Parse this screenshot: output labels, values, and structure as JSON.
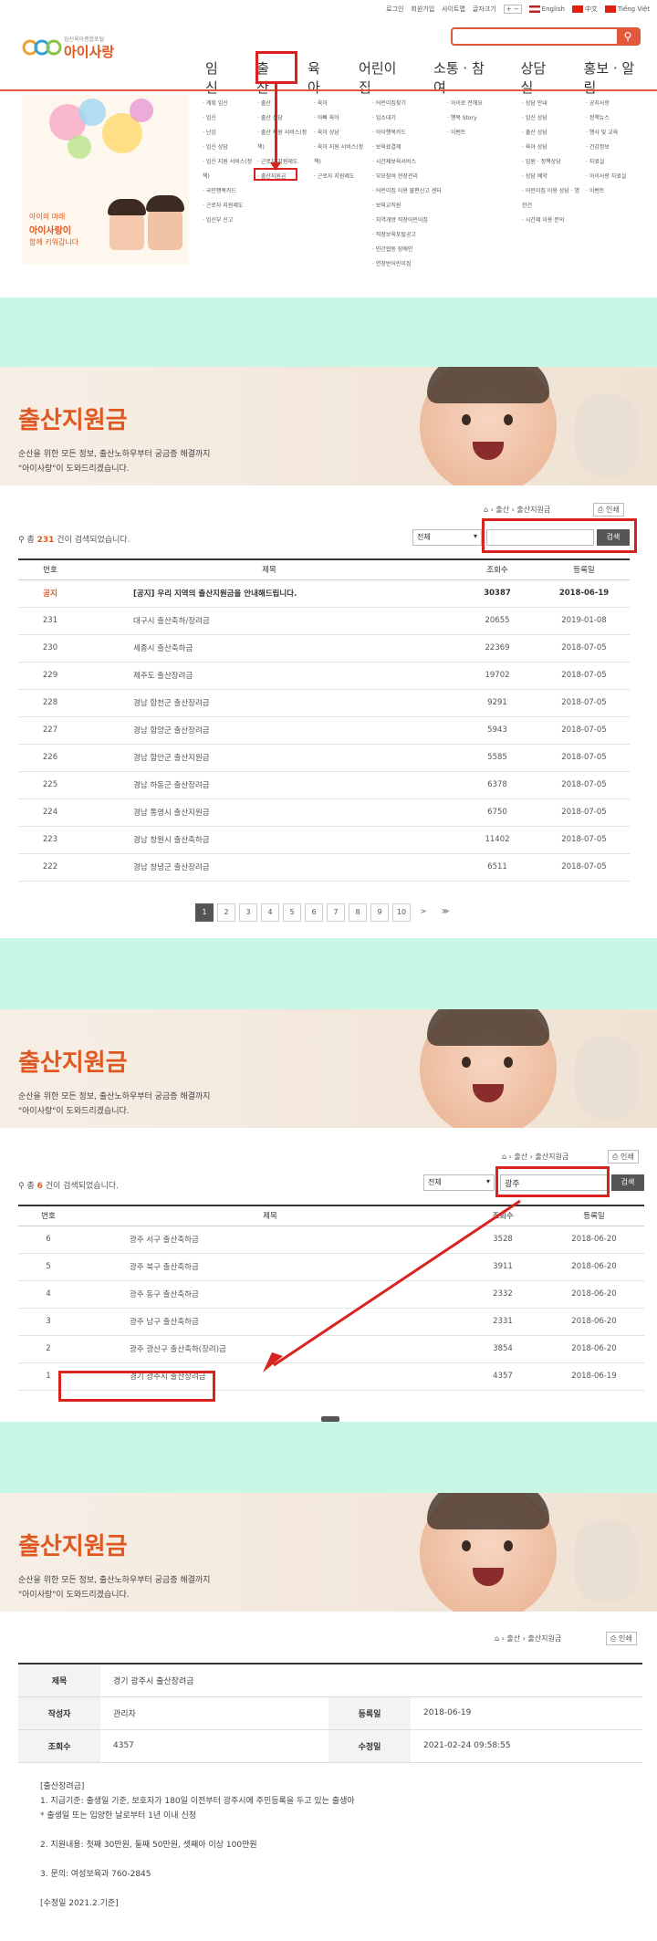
{
  "header": {
    "util": [
      "로그인",
      "회원가입",
      "사이트맵",
      "글자크기",
      "English",
      "中文",
      "Tiếng Việt"
    ],
    "logo_small": "임신육아종합포털",
    "logo_main": "아이사랑",
    "gnb": [
      "임신",
      "출산",
      "육아",
      "어린이집",
      "소통 · 참여",
      "상담실",
      "홍보 · 알림"
    ]
  },
  "submenu": {
    "col1": [
      "계획 임신",
      "임신",
      "난임",
      "임신 상담",
      "임신 지원 서비스(정책)",
      "국민행복카드",
      "근로자 지원제도",
      "임신부 신고"
    ],
    "col2": [
      "출산",
      "출산 상담",
      "출산 지원 서비스(정책)",
      "근로자 지원제도",
      "출산지원금"
    ],
    "col3": [
      "육아",
      "아빠 육아",
      "육아 상담",
      "육아 지원 서비스(정책)",
      "근로자 지원제도"
    ],
    "col4": [
      "어린이집찾기",
      "입소대기",
      "아이행복카드",
      "보육료결제",
      "시간제보육서비스",
      "부모참여 현장관리",
      "어린이집 이용 불편신고 센터",
      "보육교직원",
      "지역개방 직장어린이집",
      "직장보육포털공고",
      "민간협동 장애인",
      "연장반어린이집"
    ],
    "col5": [
      "아이로 전해요",
      "행복 Story",
      "이벤트"
    ],
    "col6": [
      "상담 안내",
      "임신 상담",
      "출산 상담",
      "육아 상담",
      "입원 · 정책상담",
      "상담 예약",
      "어린이집 이용 상담 · 명한건",
      "시간제 이용 문의"
    ],
    "col7": [
      "공지사항",
      "정책뉴스",
      "행사 및 교육",
      "건강정보",
      "자료실",
      "아이사랑 자료실",
      "이벤트"
    ]
  },
  "promo": {
    "line1": "아이의 미래",
    "line2": "아이사랑이",
    "line3": "함께 키워갑니다"
  },
  "section1": {
    "title": "출산지원금",
    "desc1": "순산을 위한 모든 정보, 출산노하우부터 궁금증 해결까지",
    "desc2": "\"아이사랑\"이 도와드리겠습니다.",
    "crumb": [
      "출산",
      "출산지원금"
    ],
    "print": "인쇄",
    "count_prefix": "총",
    "count": "231",
    "count_suffix": "건이 검색되었습니다.",
    "select": "전체",
    "search_value": "",
    "search_btn": "검색",
    "headers": [
      "번호",
      "제목",
      "조회수",
      "등록일"
    ],
    "rows": [
      [
        "공지",
        "[공지] 우리 지역의 출산지원금을 안내해드립니다.",
        "30387",
        "2018-06-19"
      ],
      [
        "231",
        "대구시 출산축하/장려금",
        "20655",
        "2019-01-08"
      ],
      [
        "230",
        "세종시 출산축하금",
        "22369",
        "2018-07-05"
      ],
      [
        "229",
        "제주도 출산장려금",
        "19702",
        "2018-07-05"
      ],
      [
        "228",
        "경남 합천군 출산장려금",
        "9291",
        "2018-07-05"
      ],
      [
        "227",
        "경남 함양군 출산장려금",
        "5943",
        "2018-07-05"
      ],
      [
        "226",
        "경남 함안군 출산지원금",
        "5585",
        "2018-07-05"
      ],
      [
        "225",
        "경남 하동군 출산장려금",
        "6378",
        "2018-07-05"
      ],
      [
        "224",
        "경남 통영시 출산지원금",
        "6750",
        "2018-07-05"
      ],
      [
        "223",
        "경남 창원시 출산축하금",
        "11402",
        "2018-07-05"
      ],
      [
        "222",
        "경남 창녕군 출산장려금",
        "6511",
        "2018-07-05"
      ]
    ],
    "pages": [
      "1",
      "2",
      "3",
      "4",
      "5",
      "6",
      "7",
      "8",
      "9",
      "10",
      ">",
      "≫"
    ]
  },
  "section2": {
    "title": "출산지원금",
    "desc1": "순산을 위한 모든 정보, 출산노하우부터 궁금증 해결까지",
    "desc2": "\"아이사랑\"이 도와드리겠습니다.",
    "crumb": [
      "출산",
      "출산지원금"
    ],
    "print": "인쇄",
    "count_prefix": "총",
    "count": "6",
    "count_suffix": "건이 검색되었습니다.",
    "select": "전체",
    "search_value": "광주",
    "search_btn": "검색",
    "headers": [
      "번호",
      "제목",
      "조회수",
      "등록일"
    ],
    "rows": [
      [
        "6",
        "광주 서구 출산축하금",
        "3528",
        "2018-06-20"
      ],
      [
        "5",
        "광주 북구 출산축하금",
        "3911",
        "2018-06-20"
      ],
      [
        "4",
        "광주 동구 출산축하금",
        "2332",
        "2018-06-20"
      ],
      [
        "3",
        "광주 남구 출산축하금",
        "2331",
        "2018-06-20"
      ],
      [
        "2",
        "광주 광산구 출산축하(장려)금",
        "3854",
        "2018-06-20"
      ],
      [
        "1",
        "경기 광주시 출산장려금",
        "4357",
        "2018-06-19"
      ]
    ]
  },
  "section3": {
    "title": "출산지원금",
    "desc1": "순산을 위한 모든 정보, 출산노하우부터 궁금증 해결까지",
    "desc2": "\"아이사랑\"이 도와드리겠습니다.",
    "crumb": [
      "출산",
      "출산지원금"
    ],
    "print": "인쇄",
    "labels": {
      "title": "제목",
      "author": "작성자",
      "reg_date": "등록일",
      "views": "조회수",
      "mod_date": "수정일"
    },
    "values": {
      "title": "경기 광주시 출산장려금",
      "author": "관리자",
      "reg_date": "2018-06-19",
      "views": "4357",
      "mod_date": "2021-02-24 09:58:55"
    },
    "body": [
      "[출산장려금]",
      "1. 지급기준: 출생일 기준, 보호자가 180일 이전부터 광주시에 주민등록을 두고 있는 출생아",
      "* 출생일 또는 입양한 날로부터 1년 이내 신청",
      "2. 지원내용: 첫째 30만원, 둘째 50만원, 셋째아 이상 100만원",
      "3. 문의: 여성보육과 760-2845",
      "[수정일 2021.2.기준]"
    ]
  }
}
